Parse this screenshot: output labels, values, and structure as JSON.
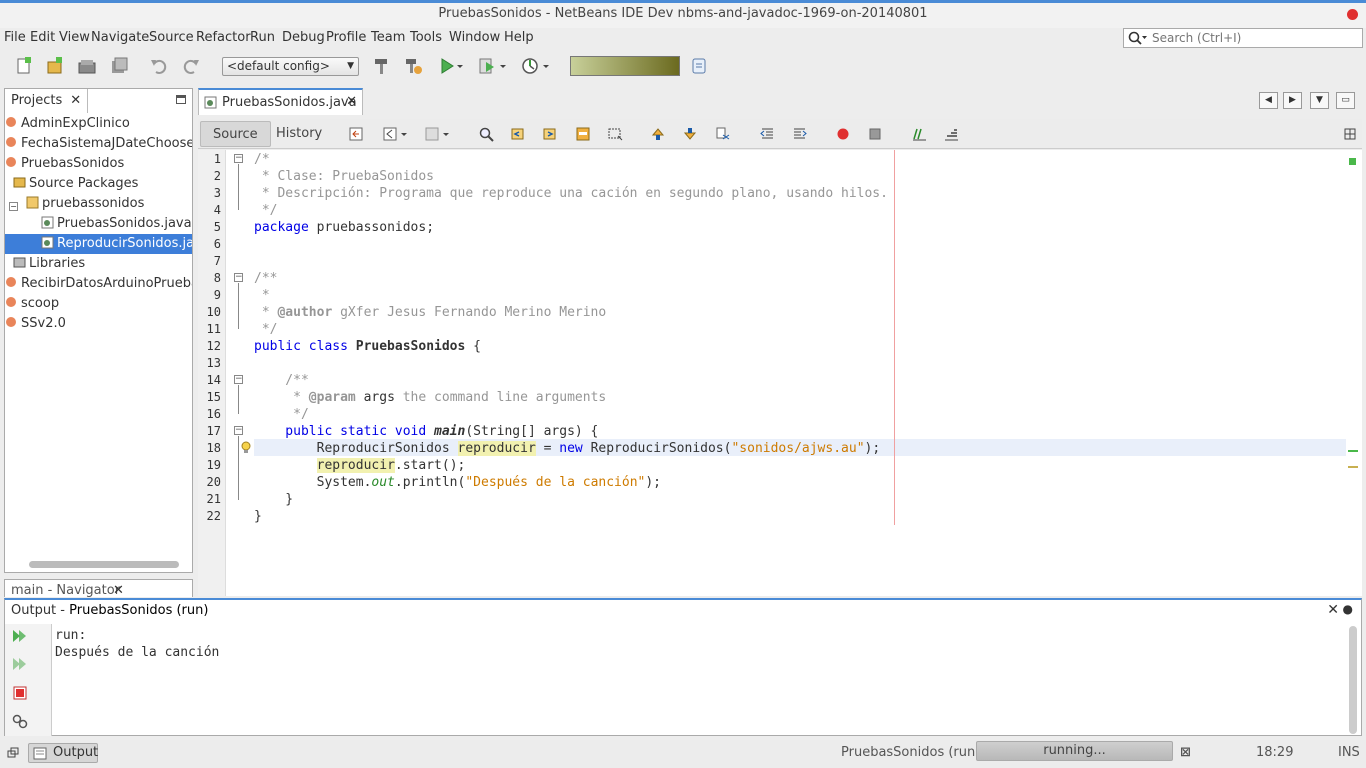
{
  "window": {
    "title": "PruebasSonidos - NetBeans IDE Dev nbms-and-javadoc-1969-on-20140801"
  },
  "menu": [
    "File",
    "Edit",
    "View",
    "Navigate",
    "Source",
    "Refactor",
    "Run",
    "Debug",
    "Profile",
    "Team",
    "Tools",
    "Window",
    "Help"
  ],
  "search": {
    "placeholder": "Search (Ctrl+I)"
  },
  "toolbar": {
    "config": "<default config>"
  },
  "projects": {
    "tab_label": "Projects",
    "items": [
      "AdminExpClinico",
      "FechaSistemaJDateChooser",
      "PruebasSonidos",
      "Source Packages",
      "pruebassonidos",
      "PruebasSonidos.java",
      "ReproducirSonidos.java",
      "Libraries",
      "RecibirDatosArduinoPrueba",
      "scoop",
      "SSv2.0"
    ]
  },
  "navigator": {
    "tab_label": "main - Navigator"
  },
  "editor": {
    "tab_label": "PruebasSonidos.java",
    "source_tab": "Source",
    "history_tab": "History",
    "lines": {
      "l1": "/*",
      "l2": " * Clase: PruebaSonidos",
      "l3": " * Descripción: Programa que reproduce una cación en segundo plano, usando hilos.",
      "l4": " */",
      "l5_kw": "package",
      "l5_rest": " pruebassonidos;",
      "l8": "/**",
      "l9": " *",
      "l10_pre": " * ",
      "l10_tag": "@author",
      "l10_rest": " gXfer Jesus Fernando Merino Merino",
      "l11": " */",
      "l12_kw": "public class",
      "l12_name": "PruebasSonidos",
      "l12_rest": " {",
      "l14": "    /**",
      "l15_pre": "     * ",
      "l15_tag": "@param",
      "l15_arg": " args",
      "l15_rest": " the command line arguments",
      "l16": "     */",
      "l17_kw": "    public static void ",
      "l17_name": "main",
      "l17_rest": "(String[] args) {",
      "l18_a": "        ReproducirSonidos ",
      "l18_var": "reproducir",
      "l18_b": " = ",
      "l18_new": "new",
      "l18_c": " ReproducirSonidos(",
      "l18_str": "\"sonidos/ajws.au\"",
      "l18_d": ");",
      "l19_pre": "        ",
      "l19_var": "reproducir",
      "l19_rest": ".start();",
      "l20_a": "        System.",
      "l20_out": "out",
      "l20_b": ".println(",
      "l20_str": "\"Después de la canción\"",
      "l20_c": ");",
      "l21": "    }",
      "l22": "}"
    }
  },
  "output": {
    "title_prefix": "Output - ",
    "title_name": "PruebasSonidos (run)",
    "text": "run:\nDespués de la canción"
  },
  "status": {
    "output_button": "Output",
    "task": "PruebasSonidos (run)",
    "progress": "running...",
    "time": "18:29",
    "mode": "INS"
  }
}
